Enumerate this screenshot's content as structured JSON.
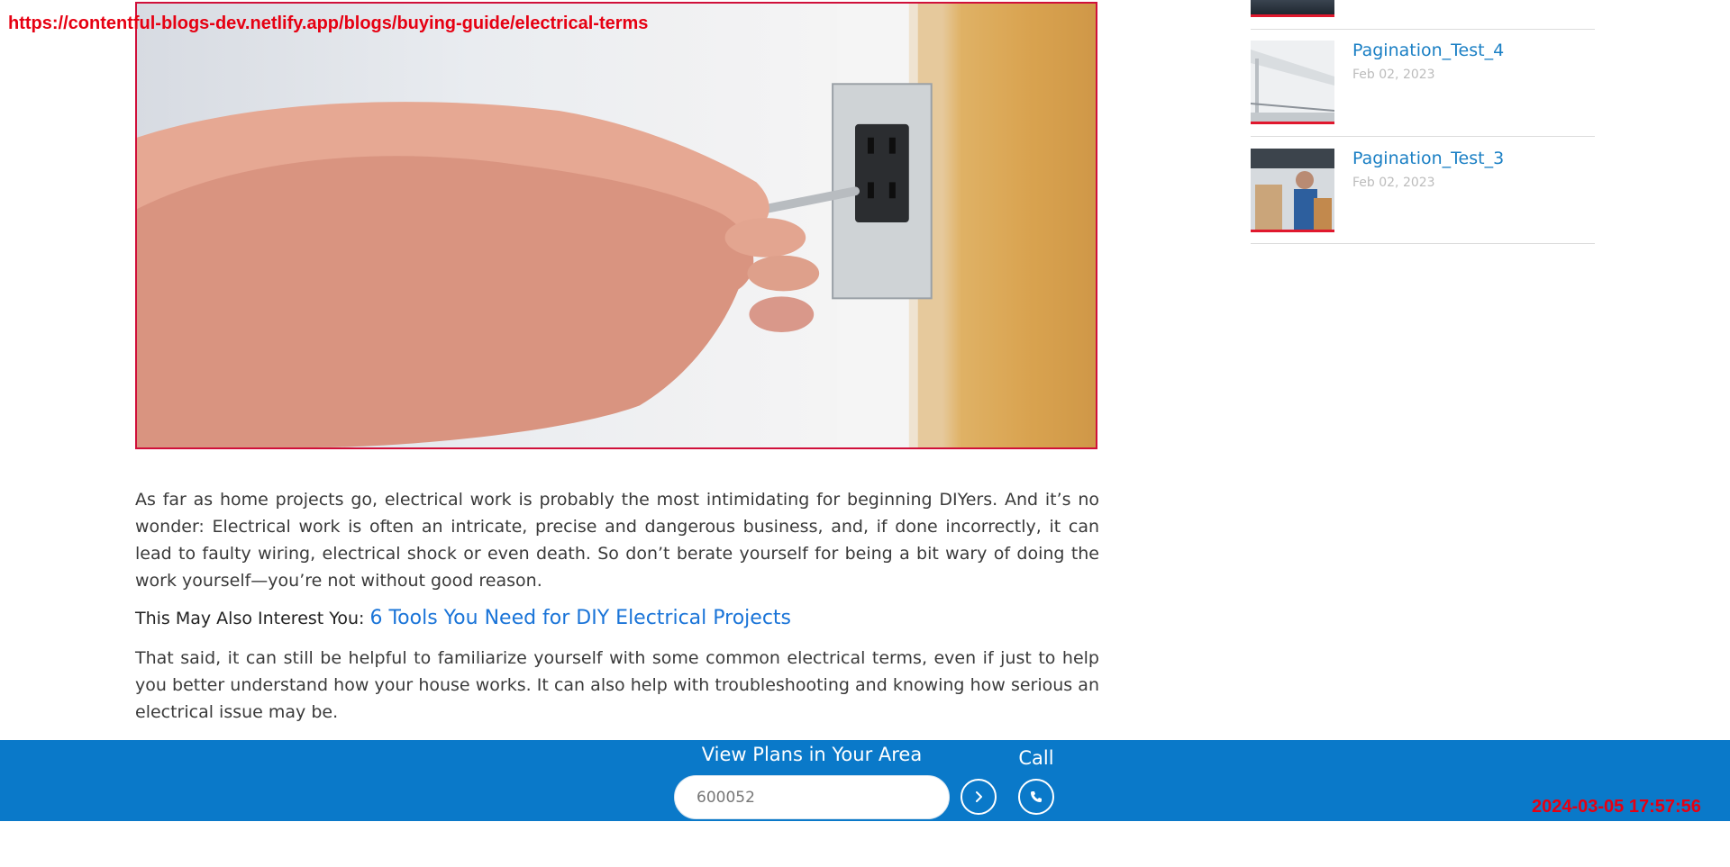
{
  "overlay": {
    "url": "https://contentful-blogs-dev.netlify.app/blogs/buying-guide/electrical-terms",
    "timestamp": "2024-03-05 17:57:56"
  },
  "hero": {
    "icon": "hands-installing-outlet-photo"
  },
  "article": {
    "paragraph_1": "As far as home projects go, electrical work is probably the most intimidating for beginning DIYers. And it’s no wonder: Electrical work is often an intricate, precise and dangerous business, and, if done incorrectly, it can lead to faulty wiring, electrical shock or even death. So don’t berate yourself for being a bit wary of doing the work yourself—you’re not without good reason.",
    "interest_label": "This May Also Interest You:",
    "interest_link": "6 Tools You Need for DIY Electrical Projects",
    "paragraph_2": "That said, it can still be helpful to familiarize yourself with some common electrical terms, even if just to help you better understand how your house works. It can also help with troubleshooting and knowing how serious an electrical issue may be."
  },
  "sidebar": {
    "items": [
      {
        "title": "Pagination_Test_4",
        "date": "Feb 02, 2023"
      },
      {
        "title": "Pagination_Test_3",
        "date": "Feb 02, 2023"
      }
    ]
  },
  "bottom_bar": {
    "plans_title": "View Plans in Your Area",
    "zip_value": "600052",
    "call_label": "Call",
    "go_icon": "chevron-right-icon",
    "call_icon": "phone-icon",
    "background_color": "#0a79c9"
  }
}
